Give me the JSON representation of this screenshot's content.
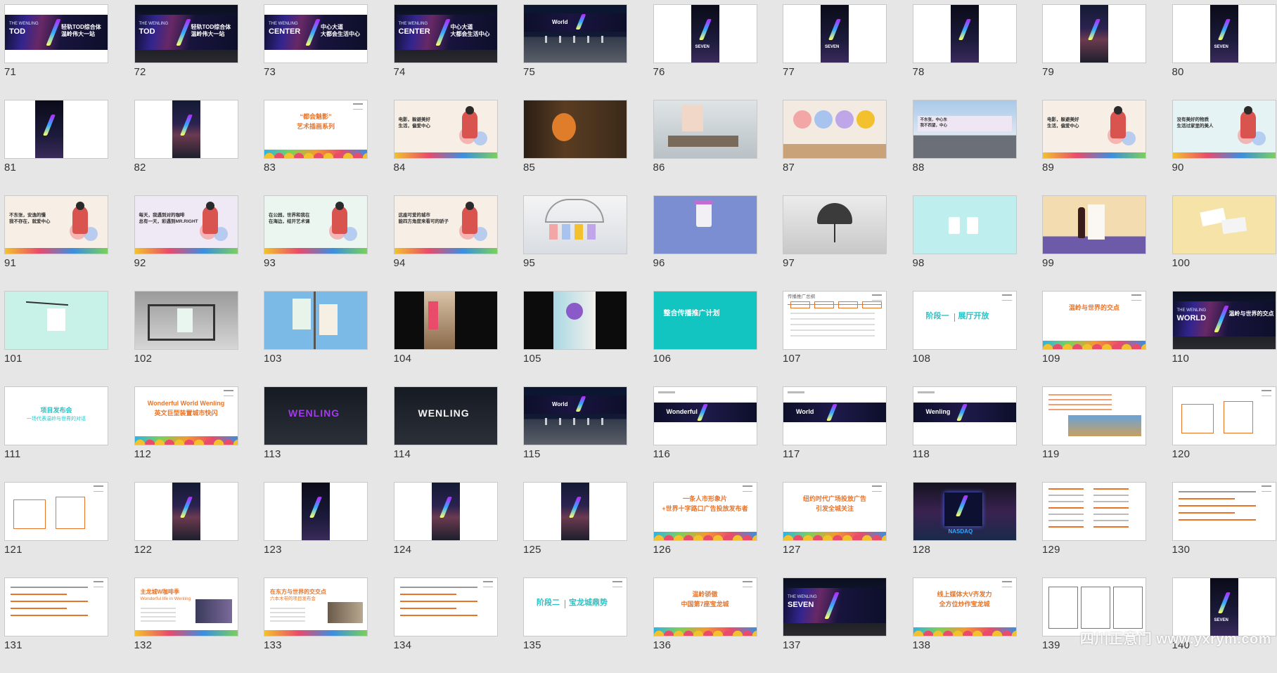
{
  "page": {
    "watermark": "四川正意门 www.yxrym.com"
  },
  "slides": [
    {
      "number": "71",
      "kind": "billboard-light",
      "texts": [
        "THE WENLING",
        "TOD",
        "轻轨TOD综合体",
        "温岭伟大一站"
      ]
    },
    {
      "number": "72",
      "kind": "billboard-night",
      "texts": [
        "THE WENLING",
        "TOD",
        "轻轨TOD综合体",
        "温岭伟大一站"
      ]
    },
    {
      "number": "73",
      "kind": "billboard-light",
      "texts": [
        "THE WENLING",
        "CENTER",
        "中心大道",
        "大都会生活中心"
      ]
    },
    {
      "number": "74",
      "kind": "billboard-night",
      "texts": [
        "THE WENLING",
        "CENTER",
        "中心大道",
        "大都会生活中心"
      ]
    },
    {
      "number": "75",
      "kind": "street-night",
      "texts": [
        "World"
      ]
    },
    {
      "number": "76",
      "kind": "poster",
      "texts": [
        "SEVEN"
      ]
    },
    {
      "number": "77",
      "kind": "poster",
      "texts": [
        "SEVEN"
      ]
    },
    {
      "number": "78",
      "kind": "poster",
      "texts": []
    },
    {
      "number": "79",
      "kind": "poster-city",
      "texts": []
    },
    {
      "number": "80",
      "kind": "poster",
      "texts": [
        "SEVEN"
      ]
    },
    {
      "number": "81",
      "kind": "poster-left",
      "texts": []
    },
    {
      "number": "82",
      "kind": "poster-city",
      "texts": []
    },
    {
      "number": "83",
      "kind": "title-wave",
      "texts": [
        "“都会魅影”",
        "艺术插画系列"
      ]
    },
    {
      "number": "84",
      "kind": "illustration",
      "texts": [
        "电影，躲避美好",
        "生活，偏爱中心"
      ]
    },
    {
      "number": "85",
      "kind": "interior-dark",
      "texts": []
    },
    {
      "number": "86",
      "kind": "interior",
      "texts": []
    },
    {
      "number": "87",
      "kind": "mural",
      "texts": []
    },
    {
      "number": "88",
      "kind": "wall-banner",
      "texts": [
        "不东张，中心东",
        "我不西望，中心"
      ]
    },
    {
      "number": "89",
      "kind": "illustration",
      "texts": [
        "电影，躲避美好",
        "生活，偏爱中心"
      ]
    },
    {
      "number": "90",
      "kind": "illustration-blue",
      "texts": [
        "没有美好的物质",
        "生活过家里的美人"
      ]
    },
    {
      "number": "91",
      "kind": "illustration",
      "texts": [
        "不东张，安逸的慢",
        "我不存在，就爱中心"
      ]
    },
    {
      "number": "92",
      "kind": "illustration-purple",
      "texts": [
        "每天，我遇到对的咖啡",
        "总有一天，彩遇到MR.RIGHT"
      ]
    },
    {
      "number": "93",
      "kind": "illustration-green",
      "texts": [
        "在公园，世界和我在",
        "在海边，结开艺术课"
      ]
    },
    {
      "number": "94",
      "kind": "illustration",
      "texts": [
        "这座可爱的城市",
        "能四方角度来看可的骄子"
      ]
    },
    {
      "number": "95",
      "kind": "arcade",
      "texts": []
    },
    {
      "number": "96",
      "kind": "cup",
      "texts": []
    },
    {
      "number": "97",
      "kind": "umbrella",
      "texts": []
    },
    {
      "number": "98",
      "kind": "lanyard",
      "texts": []
    },
    {
      "number": "99",
      "kind": "wine",
      "texts": []
    },
    {
      "number": "100",
      "kind": "cards",
      "texts": []
    },
    {
      "number": "101",
      "kind": "tag",
      "texts": []
    },
    {
      "number": "102",
      "kind": "busstop",
      "texts": []
    },
    {
      "number": "103",
      "kind": "pole-banners",
      "texts": []
    },
    {
      "number": "104",
      "kind": "standee",
      "texts": []
    },
    {
      "number": "105",
      "kind": "art-close",
      "texts": []
    },
    {
      "number": "106",
      "kind": "teal-title",
      "texts": [
        "整合传播推广计划"
      ]
    },
    {
      "number": "107",
      "kind": "timeline",
      "texts": [
        "传播推广总纲"
      ]
    },
    {
      "number": "108",
      "kind": "stage-title",
      "texts": [
        "阶段一",
        "展厅开放"
      ]
    },
    {
      "number": "109",
      "kind": "title-wave",
      "texts": [
        "温岭与世界的交点"
      ]
    },
    {
      "number": "110",
      "kind": "billboard-night",
      "texts": [
        "THE WENLING",
        "WORLD",
        "温岭与世界的交点"
      ]
    },
    {
      "number": "111",
      "kind": "teal-text",
      "texts": [
        "项目发布会",
        "一场代表温岭与世界的对话"
      ]
    },
    {
      "number": "112",
      "kind": "title-wave",
      "texts": [
        "Wonderful World Wenling",
        "英文巨型装置城市快闪"
      ]
    },
    {
      "number": "113",
      "kind": "dark-letters",
      "texts": [
        "WENLING"
      ]
    },
    {
      "number": "114",
      "kind": "dark-letters-white",
      "texts": [
        "WENLING"
      ]
    },
    {
      "number": "115",
      "kind": "street-night",
      "texts": [
        "World"
      ]
    },
    {
      "number": "116",
      "kind": "banner-strip",
      "texts": [
        "Wonderful"
      ]
    },
    {
      "number": "117",
      "kind": "banner-strip",
      "texts": [
        "World"
      ]
    },
    {
      "number": "118",
      "kind": "banner-strip",
      "texts": [
        "Wenling"
      ]
    },
    {
      "number": "119",
      "kind": "text-photo",
      "texts": []
    },
    {
      "number": "120",
      "kind": "boxes",
      "texts": []
    },
    {
      "number": "121",
      "kind": "boxes-orange",
      "texts": []
    },
    {
      "number": "122",
      "kind": "poster-city",
      "texts": []
    },
    {
      "number": "123",
      "kind": "poster",
      "texts": []
    },
    {
      "number": "124",
      "kind": "poster-city",
      "texts": []
    },
    {
      "number": "125",
      "kind": "poster-city",
      "texts": []
    },
    {
      "number": "126",
      "kind": "title-wave",
      "texts": [
        "一条人市形象片",
        "+世界十字路口广告投放发布者"
      ]
    },
    {
      "number": "127",
      "kind": "title-wave",
      "texts": [
        "纽约时代广场投放广告",
        "引发全城关注"
      ]
    },
    {
      "number": "128",
      "kind": "times-square",
      "texts": [
        "NASDAQ"
      ]
    },
    {
      "number": "129",
      "kind": "text-cols",
      "texts": []
    },
    {
      "number": "130",
      "kind": "text-orange",
      "texts": []
    },
    {
      "number": "131",
      "kind": "text-orange",
      "texts": []
    },
    {
      "number": "132",
      "kind": "event-photos",
      "texts": [
        "主龙城W咖啡季",
        "Wonderful life in Wenling"
      ]
    },
    {
      "number": "133",
      "kind": "event-photos2",
      "texts": [
        "在东方与世界的交交点",
        "六本木带的项目发布会"
      ]
    },
    {
      "number": "134",
      "kind": "text-orange",
      "texts": []
    },
    {
      "number": "135",
      "kind": "stage-title",
      "texts": [
        "阶段二",
        "宝龙城鼎势"
      ]
    },
    {
      "number": "136",
      "kind": "title-wave",
      "texts": [
        "温岭骄傲",
        "中国第7座宝龙城"
      ]
    },
    {
      "number": "137",
      "kind": "billboard-night",
      "texts": [
        "THE WENLING",
        "SEVEN"
      ]
    },
    {
      "number": "138",
      "kind": "title-wave",
      "texts": [
        "线上媒体大V齐发力",
        "全方位炒作宝龙城"
      ]
    },
    {
      "number": "139",
      "kind": "boxes3",
      "texts": []
    },
    {
      "number": "140",
      "kind": "poster",
      "texts": [
        "SEVEN"
      ]
    }
  ]
}
